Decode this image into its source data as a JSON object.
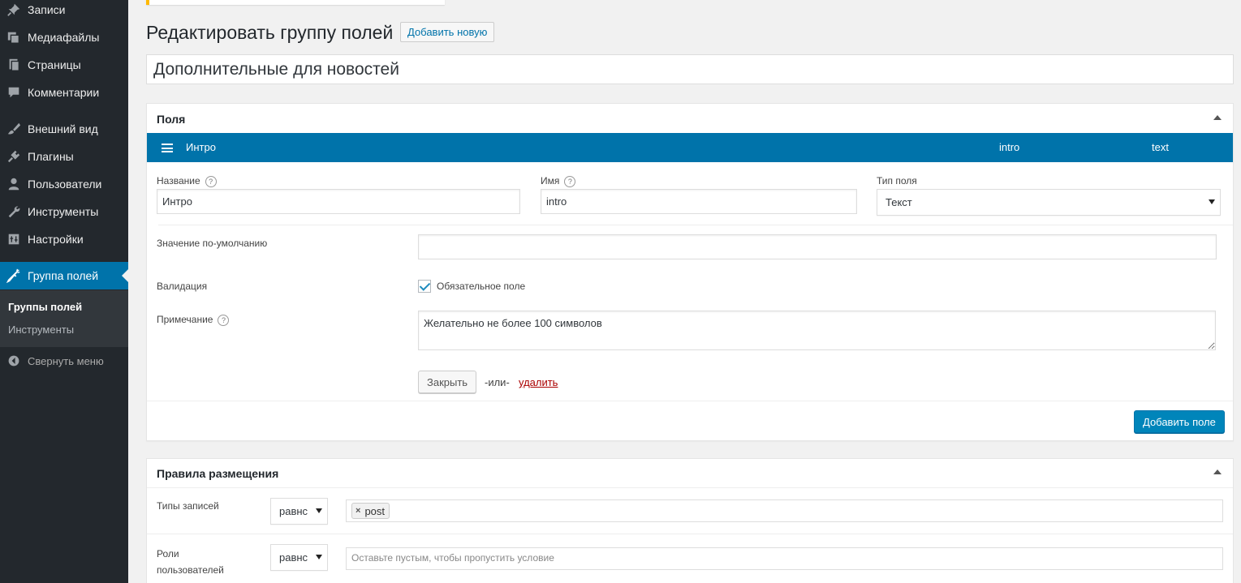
{
  "sidebar": {
    "items": [
      {
        "label": "Записи",
        "icon": "pin-icon"
      },
      {
        "label": "Медиафайлы",
        "icon": "media-icon"
      },
      {
        "label": "Страницы",
        "icon": "pages-icon"
      },
      {
        "label": "Комментарии",
        "icon": "comment-icon"
      },
      {
        "label": "Внешний вид",
        "icon": "brush-icon"
      },
      {
        "label": "Плагины",
        "icon": "plugin-icon"
      },
      {
        "label": "Пользователи",
        "icon": "user-icon"
      },
      {
        "label": "Инструменты",
        "icon": "wrench-icon"
      },
      {
        "label": "Настройки",
        "icon": "settings-icon"
      },
      {
        "label": "Группа полей",
        "icon": "carrot-icon"
      }
    ],
    "submenu": [
      "Группы полей",
      "Инструменты"
    ],
    "collapse_label": "Свернуть меню"
  },
  "header": {
    "title": "Редактировать группу полей",
    "add_new": "Добавить новую"
  },
  "group_title": "Дополнительные для новостей",
  "fields_box": {
    "title": "Поля",
    "field_row": {
      "label": "Интро",
      "name": "intro",
      "type": "text"
    },
    "label_title": "Название",
    "label_value": "Интро",
    "name_title": "Имя",
    "name_value": "intro",
    "type_title": "Тип поля",
    "type_value": "Текст",
    "default_label": "Значение по-умолчанию",
    "default_value": "",
    "validation_label": "Валидация",
    "required_label": "Обязательное поле",
    "required_checked": true,
    "note_label": "Примечание",
    "note_value": "Желательно не более 100 символов",
    "close_button": "Закрыть",
    "or_text": "-или-",
    "delete_link": "удалить",
    "add_field_button": "Добавить поле",
    "help_glyph": "?"
  },
  "location_box": {
    "title": "Правила размещения",
    "rules": [
      {
        "label": "Типы записей",
        "operator": "равнс",
        "tokens": [
          "post"
        ],
        "placeholder": ""
      },
      {
        "label": "Роли пользователей",
        "operator": "равнс",
        "tokens": [],
        "placeholder": "Оставьте пустым, чтобы пропустить условие"
      }
    ],
    "token_remove_glyph": "×"
  },
  "colors": {
    "accent": "#0073aa",
    "sidebar": "#23282d",
    "submenu": "#32373c",
    "danger": "#aa0000"
  }
}
